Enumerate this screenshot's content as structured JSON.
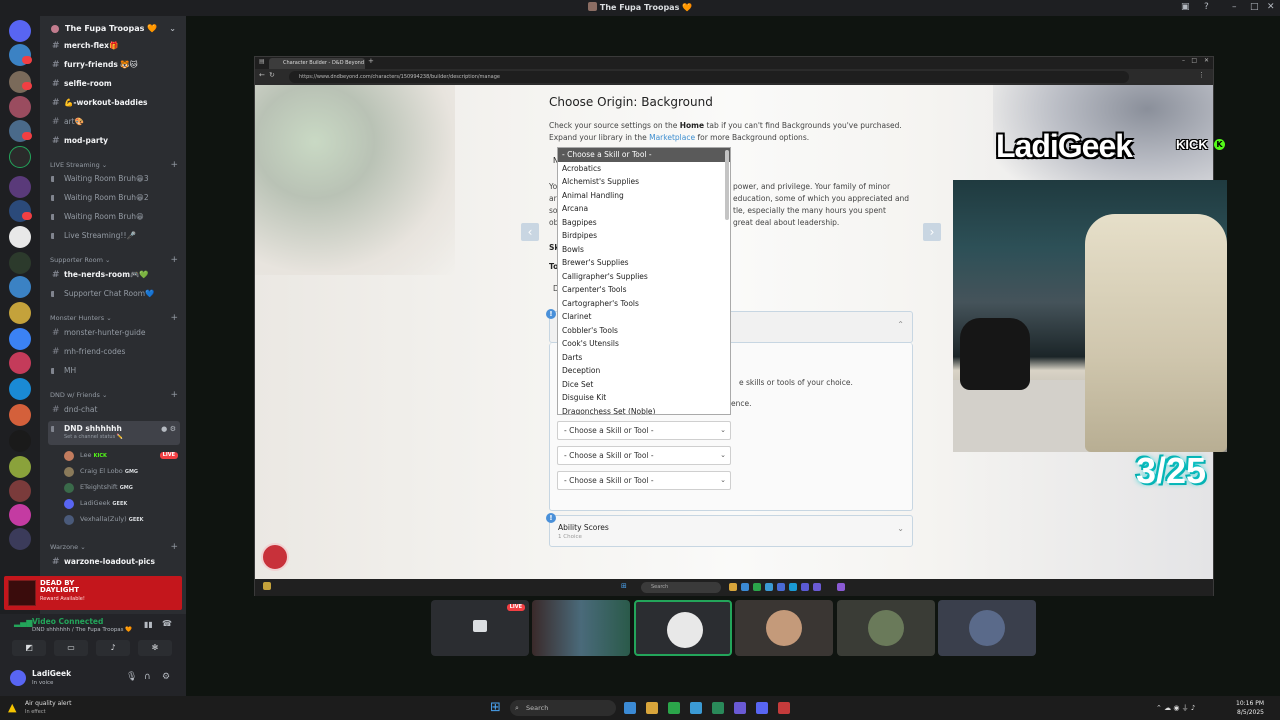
{
  "window": {
    "title": "The Fupa Troopas 🧡"
  },
  "server": {
    "name": "The Fupa Troopas 🧡",
    "channels_top": [
      {
        "name": "merch-flex🎁"
      },
      {
        "name": "furry-friends 🐯🐱"
      },
      {
        "name": "selfie-room"
      },
      {
        "name": "💪-workout-baddies"
      },
      {
        "name": "art🎨"
      },
      {
        "name": "mod-party"
      }
    ],
    "categories": [
      {
        "name": "LIVE Streaming"
      },
      {
        "name": "Supporter Room"
      },
      {
        "name": "Monster Hunters"
      },
      {
        "name": "DND w/ Friends"
      },
      {
        "name": "Warzone"
      }
    ],
    "live_channels": [
      {
        "name": "Waiting Room Bruh😁3"
      },
      {
        "name": "Waiting Room Bruh😁2"
      },
      {
        "name": "Waiting Room Bruh😁"
      },
      {
        "name": "Live Streaming!!🎤"
      }
    ],
    "supporter_channels": [
      {
        "name": "the-nerds-room🎮💚"
      },
      {
        "name": "Supporter Chat Room💙"
      }
    ],
    "monster_channels": [
      {
        "name": "monster-hunter-guide"
      },
      {
        "name": "mh-friend-codes"
      },
      {
        "name": "MH"
      }
    ],
    "dnd_channels": [
      {
        "name": "dnd-chat"
      },
      {
        "name": "DND shhhhhh"
      }
    ],
    "dnd_status": "Set a channel status ✏️",
    "voice_users": [
      {
        "name": "Lee",
        "tag": "KICK",
        "live": "LIVE"
      },
      {
        "name": "Craig El Lobo",
        "tag": "GMG",
        "live": ""
      },
      {
        "name": "ETeightshift",
        "tag": "GMG",
        "live": ""
      },
      {
        "name": "LadiGeek",
        "tag": "GEEK",
        "live": ""
      },
      {
        "name": "Vexhalla(Zuly)",
        "tag": "GEEK",
        "live": ""
      }
    ],
    "warzone_channels": [
      {
        "name": "warzone-loadout-pics"
      }
    ]
  },
  "promo": {
    "title": "DEAD BY DAYLIGHT",
    "subtitle": "Reward Available!"
  },
  "voice": {
    "status": "Video Connected",
    "channel": "DND shhhhhh / The Fupa Troopas 🧡"
  },
  "user": {
    "name": "LadiGeek",
    "status": "In voice"
  },
  "browser": {
    "tab": "Character Builder - D&D Beyond",
    "url": "https://www.dndbeyond.com/characters/150994238/builder/description/manage"
  },
  "builder": {
    "heading": "Choose Origin: Background",
    "intro_pre": "Check your source settings on the ",
    "intro_home": "Home",
    "intro_post": " tab if you can't find Backgrounds you've purchased.",
    "intro2_pre": "Expand your library in the ",
    "intro2_link": "Marketplace",
    "intro2_post": " for more Background options.",
    "desc1": "power, and privilege. Your family of minor",
    "desc2": "education, some of which you appreciated and",
    "desc3": "tle, especially the many hours you spent",
    "desc4": "great deal about leadership.",
    "choice_text": "e skills or tools of your choice.",
    "ence_text": "ence.",
    "select_placeholder": "- Choose a Skill or Tool -",
    "dropdown_options": [
      "- Choose a Skill or Tool -",
      "Acrobatics",
      "Alchemist's Supplies",
      "Animal Handling",
      "Arcana",
      "Bagpipes",
      "Birdpipes",
      "Bowls",
      "Brewer's Supplies",
      "Calligrapher's Supplies",
      "Carpenter's Tools",
      "Cartographer's Tools",
      "Clarinet",
      "Cobbler's Tools",
      "Cook's Utensils",
      "Darts",
      "Deception",
      "Dice Set",
      "Disguise Kit",
      "Dragonchess Set (Noble)"
    ],
    "ability_title": "Ability Scores",
    "ability_sub": "1 Choice"
  },
  "inner_taskbar": {
    "search": "Search"
  },
  "overlay": {
    "name": "LadiGeek",
    "kick": "KICK",
    "counter": "3/25"
  },
  "taskbar": {
    "alert": "Air quality alert",
    "alert_sub": "In effect",
    "search": "Search",
    "time": "10:16 PM",
    "date": "8/5/2025"
  }
}
